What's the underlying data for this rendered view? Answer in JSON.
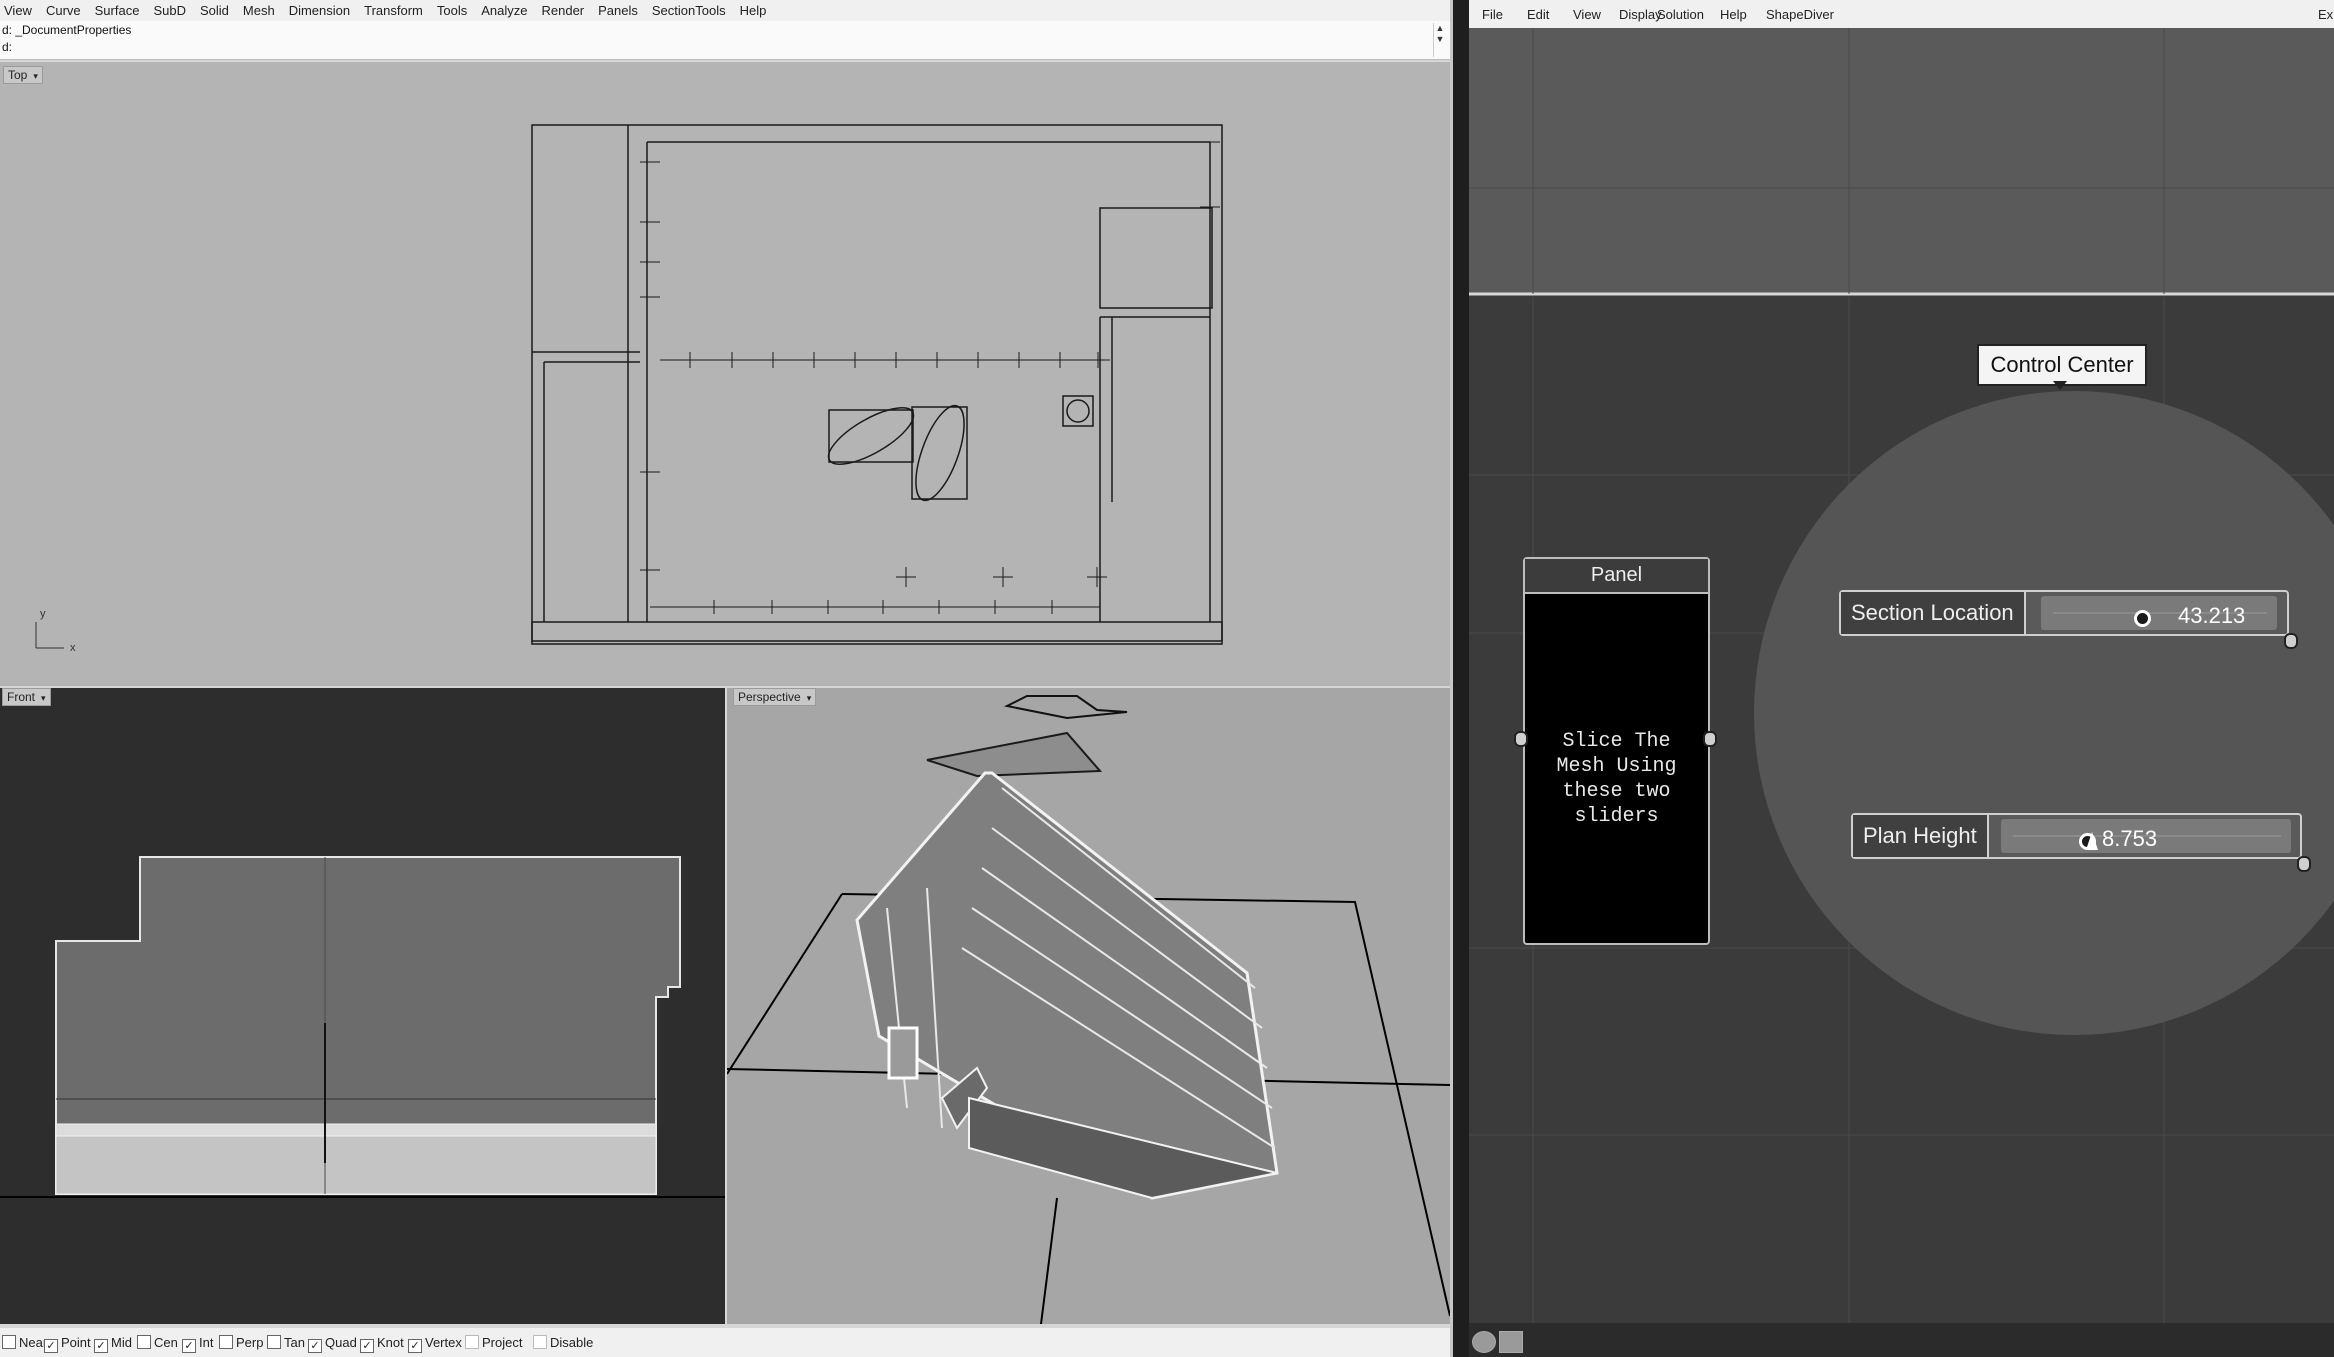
{
  "rhino": {
    "menu": [
      "View",
      "Curve",
      "Surface",
      "SubD",
      "Solid",
      "Mesh",
      "Dimension",
      "Transform",
      "Tools",
      "Analyze",
      "Render",
      "Panels",
      "SectionTools",
      "Help"
    ],
    "command_history": "d: _DocumentProperties",
    "command_prompt": "d:",
    "viewports": {
      "top": "Top",
      "front": "Front",
      "perspective": "Perspective"
    },
    "axis_labels": {
      "y": "y",
      "x": "x"
    },
    "osnap": [
      {
        "label": "Near",
        "checked": false
      },
      {
        "label": "Point",
        "checked": true
      },
      {
        "label": "Mid",
        "checked": true
      },
      {
        "label": "Cen",
        "checked": false
      },
      {
        "label": "Int",
        "checked": true
      },
      {
        "label": "Perp",
        "checked": false
      },
      {
        "label": "Tan",
        "checked": false
      },
      {
        "label": "Quad",
        "checked": true
      },
      {
        "label": "Knot",
        "checked": true
      },
      {
        "label": "Vertex",
        "checked": true
      },
      {
        "label": "Project",
        "checked": false
      },
      {
        "label": "Disable",
        "checked": false
      }
    ]
  },
  "grasshopper": {
    "menu": [
      "File",
      "Edit",
      "View",
      "Display",
      "Solution",
      "Help",
      "ShapeDiver"
    ],
    "menu_cut": "Exp",
    "group_label": "Control Center",
    "panel": {
      "title": "Panel",
      "text": "Slice The\nMesh Using\nthese two\nsliders"
    },
    "sliders": [
      {
        "name": "Section Location",
        "value": "43.213",
        "position": 0.42
      },
      {
        "name": "Plan Height",
        "value": "8.753",
        "position": 0.28
      }
    ],
    "icons": [
      "sphere-icon",
      "mesh-icon"
    ]
  },
  "colors": {
    "rhino_viewport_bg": "#b4b4b4",
    "gh_canvas_bg": "#3b3b3b",
    "panel_bg": "#000000"
  }
}
